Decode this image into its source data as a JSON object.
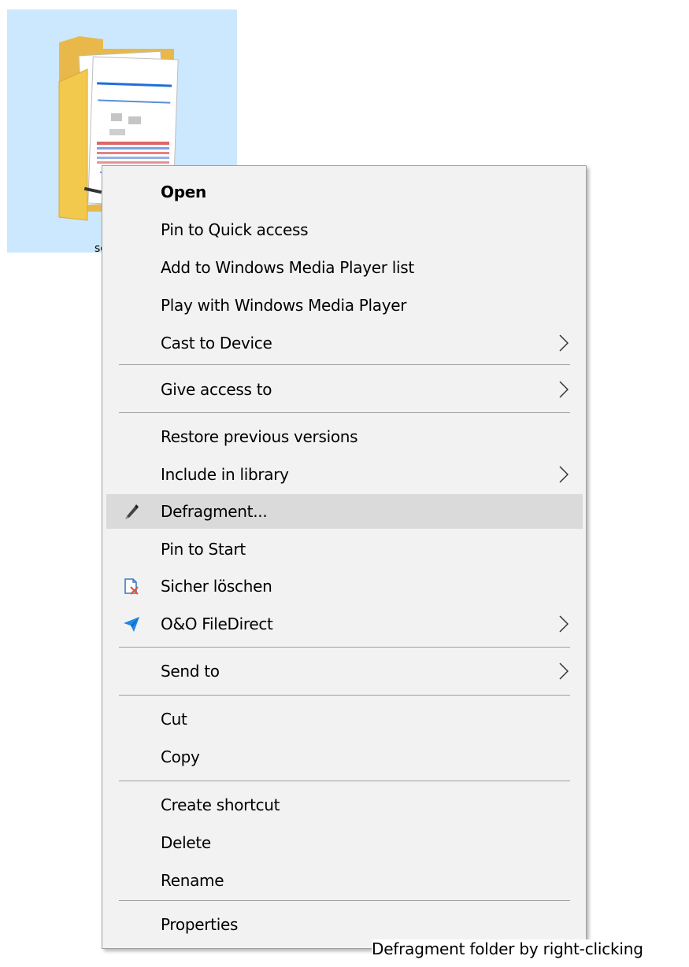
{
  "folder": {
    "label": "sc",
    "icon": "folder-icon"
  },
  "menu": {
    "items": [
      {
        "label": "Open",
        "bold": true
      },
      {
        "label": "Pin to Quick access"
      },
      {
        "label": "Add to Windows Media Player list"
      },
      {
        "label": "Play with Windows Media Player"
      },
      {
        "label": "Cast to Device",
        "submenu": true
      },
      {
        "label": "Give access to",
        "submenu": true
      },
      {
        "label": "Restore previous versions"
      },
      {
        "label": "Include in library",
        "submenu": true
      },
      {
        "label": "Defragment...",
        "icon": "defrag-pen-icon",
        "highlighted": true
      },
      {
        "label": "Pin to Start"
      },
      {
        "label": "Sicher löschen",
        "icon": "secure-delete-icon"
      },
      {
        "label": "O&O FileDirect",
        "icon": "paper-plane-icon",
        "submenu": true
      },
      {
        "label": "Send to",
        "submenu": true
      },
      {
        "label": "Cut"
      },
      {
        "label": "Copy"
      },
      {
        "label": "Create shortcut"
      },
      {
        "label": "Delete"
      },
      {
        "label": "Rename"
      },
      {
        "label": "Properties"
      }
    ]
  },
  "caption": "Defragment folder by right-clicking",
  "colors": {
    "selection": "#cce8ff",
    "menu_bg": "#f2f2f2",
    "hover": "#dadada",
    "separator": "#a0a0a0",
    "accent_blue": "#1e88e5"
  }
}
